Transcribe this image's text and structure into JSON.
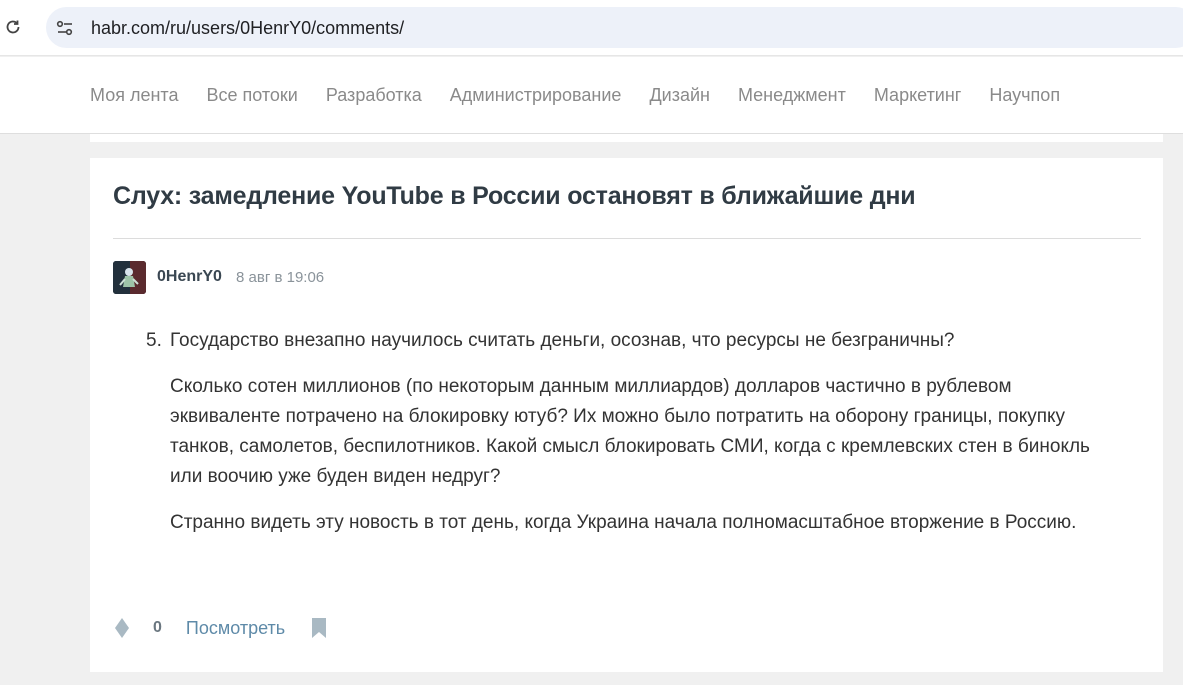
{
  "browser": {
    "url": "habr.com/ru/users/0HenrY0/comments/"
  },
  "nav": {
    "items": [
      "Моя лента",
      "Все потоки",
      "Разработка",
      "Администрирование",
      "Дизайн",
      "Менеджмент",
      "Маркетинг",
      "Научпоп"
    ]
  },
  "article": {
    "title": "Слух: замедление YouTube в России остановят в ближайшие дни"
  },
  "comment": {
    "author": "0HenrY0",
    "time": "8 авг в 19:06",
    "list_number": "5.",
    "first_line": "Государство внезапно научилось считать деньги, осознав, что ресурсы не безграничны?",
    "paragraph_1": "Сколько сотен миллионов (по некоторым данным миллиардов) долларов частично в рублевом эквиваленте потрачено на блокировку ютуб? Их можно было потратить на оборону границы, покупку танков, самолетов, беспилотников. Какой смысл блокировать СМИ, когда с кремлевских стен в бинокль или воочию уже буден виден недруг?",
    "paragraph_2": "Странно видеть эту новость в тот день, когда Украина начала полномасштабное вторжение в Россию.",
    "vote_count": "0",
    "view_label": "Посмотреть"
  },
  "colors": {
    "accent_link": "#5e8aa8",
    "title": "#303b44",
    "nav_text": "#8a8a8a"
  }
}
